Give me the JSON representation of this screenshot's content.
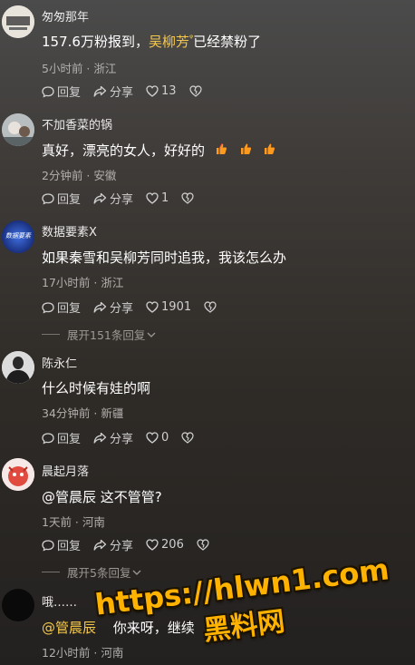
{
  "comments": [
    {
      "user": "匆匆那年",
      "text_plain": "157.6万粉报到，",
      "mention": "吴柳芳",
      "text_after": "已经禁粉了",
      "meta": "5小时前 · 浙江",
      "reply": "回复",
      "share": "分享",
      "likes": "13"
    },
    {
      "user": "不加香菜的锅",
      "text": "真好，漂亮的女人，好好的",
      "meta": "2分钟前 · 安徽",
      "reply": "回复",
      "share": "分享",
      "likes": "1"
    },
    {
      "user": "数据要素X",
      "avatar_text": "数据要素",
      "text": "如果秦雪和吴柳芳同时追我，我该怎么办",
      "meta": "17小时前 · 浙江",
      "reply": "回复",
      "share": "分享",
      "likes": "1901",
      "expand": "展开151条回复"
    },
    {
      "user": "陈永仁",
      "text": "什么时候有娃的啊",
      "meta": "34分钟前 · 新疆",
      "reply": "回复",
      "share": "分享",
      "likes": "0"
    },
    {
      "user": "晨起月落",
      "text": "@管晨辰  这不管管?",
      "meta": "1天前 · 河南",
      "reply": "回复",
      "share": "分享",
      "likes": "206",
      "expand": "展开5条回复"
    },
    {
      "user": "哦……",
      "mention": "@管晨辰",
      "text_after": "你来呀，继续",
      "meta": "12小时前 · 河南"
    }
  ],
  "watermark": {
    "url": "https://hlwn1.com",
    "cn": "黑料网"
  },
  "colors": {
    "mention": "#f7c94a",
    "watermark": "#ffb300"
  }
}
